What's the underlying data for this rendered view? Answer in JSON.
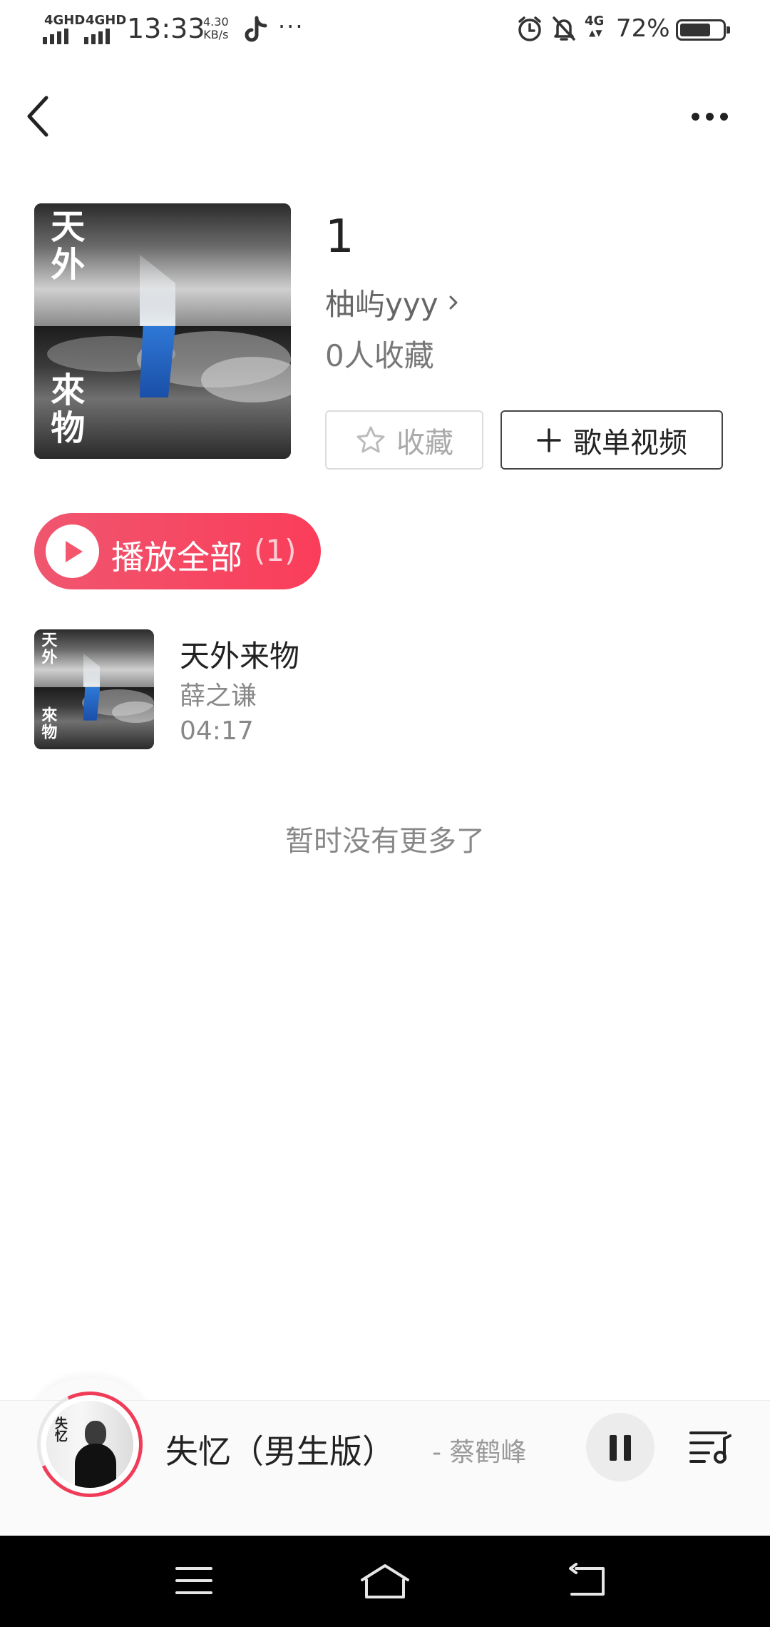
{
  "status_bar": {
    "sim1": "4GHD",
    "sim2": "4GHD",
    "time": "13:33",
    "speed_value": "4.30",
    "speed_unit": "KB/s",
    "more": "···",
    "network": "4G",
    "battery_text": "72%",
    "battery_level": 0.72,
    "icons": [
      "tiktok-icon",
      "alarm-icon",
      "bell-off-icon",
      "battery-icon"
    ]
  },
  "header": {
    "icons": [
      "back-icon",
      "more-icon"
    ]
  },
  "playlist": {
    "cover_text_top": "天外",
    "cover_text_bottom": "來物",
    "title": "1",
    "creator": "柚屿yyy",
    "collect_count": "0人收藏",
    "collect_button": "收藏",
    "video_button": "歌单视频"
  },
  "play_all": {
    "label": "播放全部",
    "count": "(1)"
  },
  "songs": [
    {
      "name": "天外来物",
      "artist": "薛之谦",
      "duration": "04:17",
      "thumb_top": "天外",
      "thumb_bottom": "來物"
    }
  ],
  "no_more": "暂时没有更多了",
  "player": {
    "song": "失忆（男生版）",
    "artist": "- 蔡鹤峰",
    "cover_text": "失忆",
    "icons": [
      "pause-icon",
      "playlist-icon"
    ],
    "accent": "#f03c58"
  },
  "nav": {
    "icons": [
      "menu-icon",
      "home-icon",
      "back-nav-icon"
    ]
  },
  "colors": {
    "play_all_start": "#f0566f",
    "play_all_end": "#fa3d5a",
    "muted_text": "#888888"
  }
}
